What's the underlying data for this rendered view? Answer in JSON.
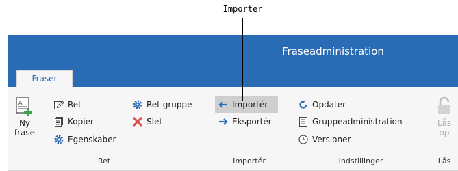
{
  "callout": {
    "label": "Importer"
  },
  "window": {
    "title": "Fraseadministration"
  },
  "tabs": [
    {
      "label": "Fraser"
    }
  ],
  "groups": {
    "ret": {
      "label": "Ret",
      "new_phrase": {
        "line1": "Ny",
        "line2": "frase"
      },
      "edit": "Ret",
      "copy": "Kopier",
      "properties": "Egenskaber",
      "edit_group": "Ret gruppe",
      "delete": "Slet"
    },
    "importer": {
      "label": "Importér",
      "import": "Importér",
      "export": "Eksportér"
    },
    "settings": {
      "label": "Indstillinger",
      "update": "Opdater",
      "group_admin": "Gruppeadministration",
      "versions": "Versioner"
    },
    "lock": {
      "label": "Lås",
      "lock_button": {
        "line1": "Lås",
        "line2": "op"
      }
    }
  },
  "colors": {
    "accent": "#2a6bb6",
    "ribbon_bg": "#f6f6f6",
    "delete_red": "#d9534f",
    "icon_blue": "#2a6bb6",
    "add_green": "#3fa34d"
  }
}
